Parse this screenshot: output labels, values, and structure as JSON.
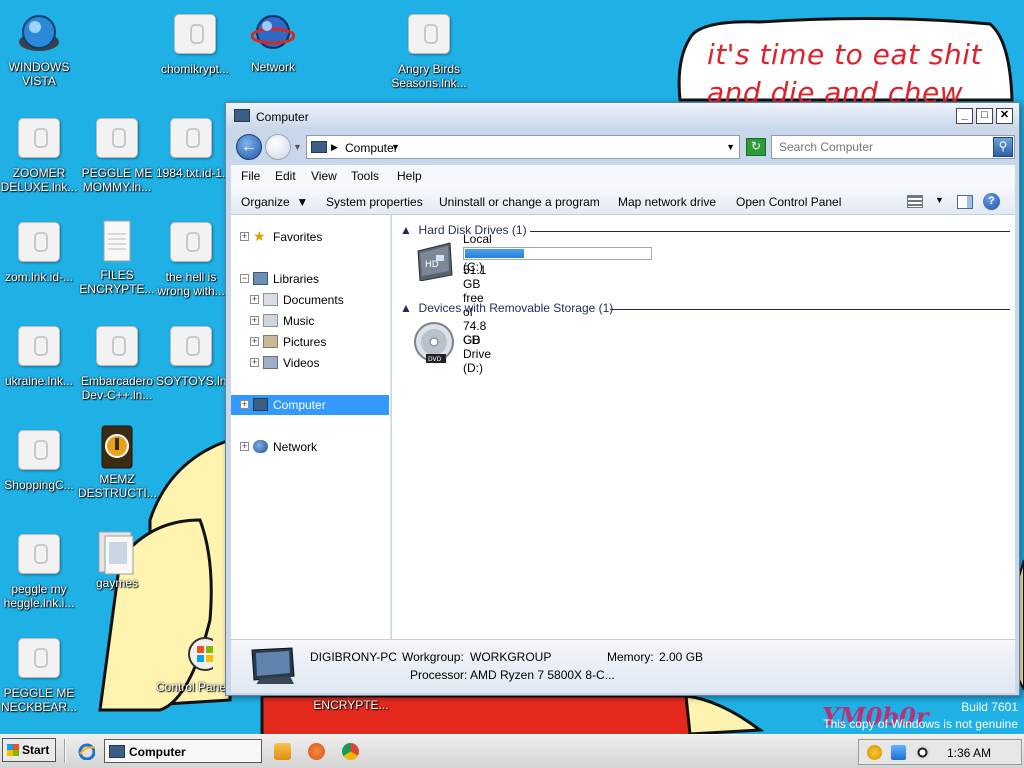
{
  "wallpaper": {
    "meme_line1": "it's time to eat shit",
    "meme_line2": "and die and chew",
    "build": "Build 7601",
    "genuine": "This copy of Windows is not genuine",
    "watermark": "YM0b0r",
    "colors": {
      "background": "#1fb0e6",
      "meme_text": "#e0202a"
    }
  },
  "desktop_icons": [
    {
      "name": "windows-vista",
      "label": "WINDOWS VISTA",
      "icon": "vista-icon"
    },
    {
      "name": "chomikrypt",
      "label": "chomikrypt...",
      "icon": "generic-file-icon"
    },
    {
      "name": "network",
      "label": "Network",
      "icon": "network-globe-icon"
    },
    {
      "name": "angry-birds",
      "label": "Angry Birds Seasons.lnk...",
      "icon": "generic-file-icon"
    },
    {
      "name": "zoomer-deluxe",
      "label": "ZOOMER DELUXE.lnk...",
      "icon": "generic-file-icon"
    },
    {
      "name": "peggle-me-mommy",
      "label": "PEGGLE ME MOMMY.ln...",
      "icon": "generic-file-icon"
    },
    {
      "name": "1984-txt",
      "label": "1984.txt.id-1...",
      "icon": "generic-file-icon"
    },
    {
      "name": "zom-lnk",
      "label": "zom.lnk.id-...",
      "icon": "generic-file-icon"
    },
    {
      "name": "files-encrypted",
      "label": "FILES ENCRYPTE...",
      "icon": "text-file-icon"
    },
    {
      "name": "the-hell-is-wrong",
      "label": "the hell is wrong with...",
      "icon": "generic-file-icon"
    },
    {
      "name": "ukraine-lnk",
      "label": "ukraine.lnk...",
      "icon": "generic-file-icon"
    },
    {
      "name": "embarcadero",
      "label": "Embarcadero Dev-C++.ln...",
      "icon": "generic-file-icon"
    },
    {
      "name": "soytoys",
      "label": "SOYTOYS.ln...",
      "icon": "generic-file-icon"
    },
    {
      "name": "shoppingc",
      "label": "ShoppingC...",
      "icon": "generic-file-icon"
    },
    {
      "name": "memz",
      "label": "MEMZ DESTRUCTI...",
      "icon": "memz-icon"
    },
    {
      "name": "peggle-my-heggle",
      "label": "peggle my heggle.lnk.i...",
      "icon": "generic-file-icon"
    },
    {
      "name": "gaymes",
      "label": "gaymes",
      "icon": "folder-icon"
    },
    {
      "name": "peggle-me-neckbear",
      "label": "PEGGLE ME NECKBEAR...",
      "icon": "generic-file-icon"
    },
    {
      "name": "control-panel",
      "label": "Control Panel",
      "icon": "control-panel-icon"
    },
    {
      "name": "encrypte-partial",
      "label": "ENCRYPTE...",
      "icon": ""
    }
  ],
  "window": {
    "title": "Computer",
    "controls": {
      "minimize": "_",
      "maximize": "□",
      "close": "✕"
    },
    "address": {
      "location": "Computer"
    },
    "search": {
      "placeholder": "Search Computer"
    },
    "menu": [
      "File",
      "Edit",
      "View",
      "Tools",
      "Help"
    ],
    "commands": [
      "Organize",
      "System properties",
      "Uninstall or change a program",
      "Map network drive",
      "Open Control Panel"
    ],
    "nav": {
      "favorites": "Favorites",
      "libraries": "Libraries",
      "library_items": [
        "Documents",
        "Music",
        "Pictures",
        "Videos"
      ],
      "computer": "Computer",
      "network": "Network"
    },
    "groups": {
      "hard_disks": "Hard Disk Drives (1)",
      "removable": "Devices with Removable Storage (1)"
    },
    "drives": {
      "c": {
        "name": "Local Disk (C:)",
        "free_text": "51.1 GB free of 74.8 GB",
        "used_fraction": 0.317
      },
      "d": {
        "name": "CD Drive (D:)"
      }
    },
    "details": {
      "pc_name": "DIGIBRONY-PC",
      "workgroup_label": "Workgroup:",
      "workgroup": "WORKGROUP",
      "memory_label": "Memory:",
      "memory": "2.00 GB",
      "processor_label": "Processor:",
      "processor": "AMD Ryzen 7 5800X 8-C..."
    }
  },
  "taskbar": {
    "start": "Start",
    "task_window": "Computer",
    "clock": "1:36 AM"
  }
}
